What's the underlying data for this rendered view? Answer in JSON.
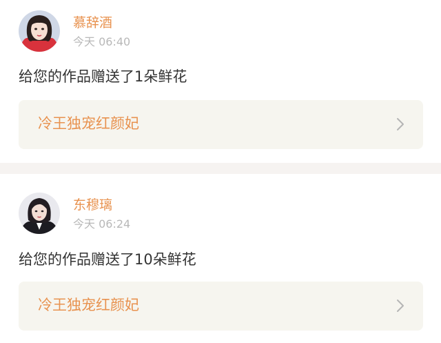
{
  "feed": [
    {
      "user_name": "慕辞酒",
      "time": "今天 06:40",
      "message": "给您的作品赠送了1朵鲜花",
      "work_title": "冷王独宠红颜妃",
      "avatar_icon": "user-avatar-girl-red"
    },
    {
      "user_name": "东穆璃",
      "time": "今天 06:24",
      "message": "给您的作品赠送了10朵鲜花",
      "work_title": "冷王独宠红颜妃",
      "avatar_icon": "user-avatar-girl-dark"
    }
  ],
  "colors": {
    "accent": "#e8924f",
    "time_gray": "#b8b8b8",
    "link_bg": "#f6f5ef",
    "divider": "#f6f3f1",
    "text": "#333333"
  }
}
